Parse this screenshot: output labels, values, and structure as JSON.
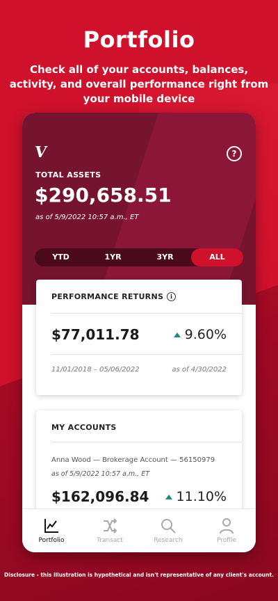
{
  "promo": {
    "title": "Portfolio",
    "subtitle": "Check all of your accounts, balances, activity, and overall performance right from your mobile device",
    "disclosure": "Disclosure - this illustration is hypothetical and isn't representative of any client's account."
  },
  "app": {
    "logo": "V",
    "help_icon": "?",
    "total_assets_label": "TOTAL ASSETS",
    "total_assets_value": "$290,658.51",
    "total_assets_as_of": "as of 5/9/2022 10:57 a.m., ET",
    "range_tabs": [
      {
        "label": "YTD",
        "active": false
      },
      {
        "label": "1YR",
        "active": false
      },
      {
        "label": "3YR",
        "active": false
      },
      {
        "label": "ALL",
        "active": true
      }
    ]
  },
  "performance": {
    "title": "PERFORMANCE RETURNS",
    "info_icon": "i",
    "amount": "$77,011.78",
    "return_pct": "9.60%",
    "date_range": "11/01/2018 – 05/06/2022",
    "as_of": "as of 4/30/2022"
  },
  "accounts": {
    "title": "MY ACCOUNTS",
    "items": [
      {
        "name": "Anna Wood — Brokerage Account — 56150979",
        "as_of": "as of 5/9/2022 10:57 a.m., ET",
        "balance": "$162,096.84",
        "return_pct": "11.10%"
      }
    ]
  },
  "nav": [
    {
      "label": "Portfolio",
      "icon": "chart-line-icon",
      "active": true
    },
    {
      "label": "Transact",
      "icon": "shuffle-icon",
      "active": false
    },
    {
      "label": "Research",
      "icon": "search-icon",
      "active": false
    },
    {
      "label": "Profile",
      "icon": "person-icon",
      "active": false
    }
  ],
  "colors": {
    "brand_red": "#d0112b",
    "header_maroon": "#76142f",
    "positive_green": "#1f8a78"
  }
}
